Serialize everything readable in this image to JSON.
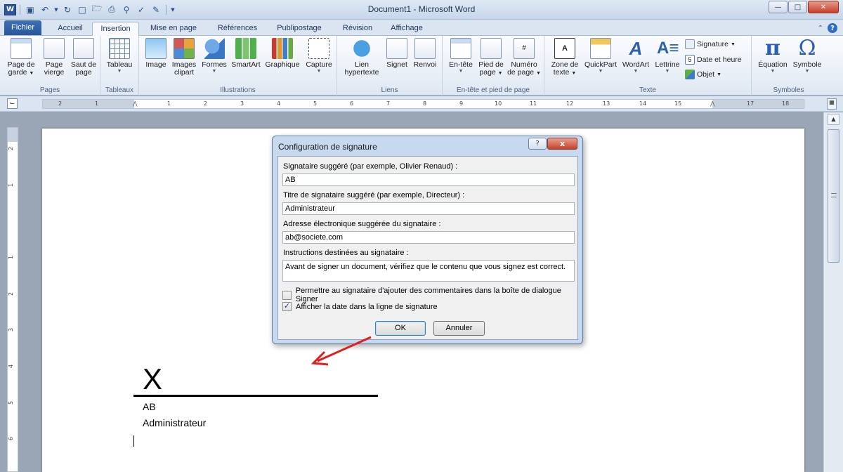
{
  "window": {
    "title": "Document1 - Microsoft Word",
    "app_icon": "W"
  },
  "tabs": [
    {
      "label": "Fichier"
    },
    {
      "label": "Accueil"
    },
    {
      "label": "Insertion"
    },
    {
      "label": "Mise en page"
    },
    {
      "label": "Références"
    },
    {
      "label": "Publipostage"
    },
    {
      "label": "Révision"
    },
    {
      "label": "Affichage"
    }
  ],
  "ribbon": {
    "groups": {
      "pages": "Pages",
      "tables": "Tableaux",
      "illustrations": "Illustrations",
      "links": "Liens",
      "header_footer": "En-tête et pied de page",
      "text": "Texte",
      "symbols": "Symboles"
    },
    "buttons": {
      "cover_page": [
        "Page de",
        "garde"
      ],
      "blank_page": [
        "Page",
        "vierge"
      ],
      "page_break": [
        "Saut de",
        "page"
      ],
      "table": "Tableau",
      "image": "Image",
      "clipart": [
        "Images",
        "clipart"
      ],
      "shapes": "Formes",
      "smartart": "SmartArt",
      "chart": "Graphique",
      "capture": "Capture",
      "hyperlink": [
        "Lien",
        "hypertexte"
      ],
      "bookmark": "Signet",
      "crossref": "Renvoi",
      "header": "En-tête",
      "footer": [
        "Pied de",
        "page"
      ],
      "page_number": [
        "Numéro",
        "de page"
      ],
      "textbox": [
        "Zone de",
        "texte"
      ],
      "quickpart": "QuickPart",
      "wordart": "WordArt",
      "dropcap": "Lettrine",
      "signature": "Signature",
      "date_time": "Date et heure",
      "object": "Objet",
      "equation": "Équation",
      "symbol": "Symbole"
    }
  },
  "ruler": {
    "numbers": [
      "2",
      "1",
      "1",
      "1",
      "2",
      "3",
      "4",
      "5",
      "6",
      "7",
      "8",
      "9",
      "10",
      "11",
      "12",
      "13",
      "14",
      "15",
      "17",
      "18"
    ]
  },
  "vruler": {
    "numbers": [
      "2",
      "1",
      "1",
      "2",
      "3",
      "4",
      "5",
      "6"
    ]
  },
  "document": {
    "signature_x": "X",
    "signer_name": "AB",
    "signer_title": "Administrateur"
  },
  "dialog": {
    "title": "Configuration de signature",
    "help_button": "?",
    "close_button": "x",
    "signer_label": "Signataire suggéré (par exemple, Olivier Renaud) :",
    "signer_value": "AB",
    "title_label": "Titre de signataire suggéré (par exemple, Directeur) :",
    "title_value": "Administrateur",
    "email_label": "Adresse électronique suggérée du signataire :",
    "email_value": "ab@societe.com",
    "instructions_label": "Instructions destinées au signataire :",
    "instructions_value": "Avant de signer un document, vérifiez que le contenu que vous signez est correct.",
    "allow_comments_label": "Permettre au signataire d'ajouter des commentaires dans la boîte de dialogue Signer",
    "allow_comments_checked": false,
    "show_date_label": "Afficher la date dans la ligne de signature",
    "show_date_checked": true,
    "ok_label": "OK",
    "cancel_label": "Annuler"
  },
  "colors": {
    "file_tab": "#2a5699",
    "annotation_arrow": "#e02020"
  }
}
